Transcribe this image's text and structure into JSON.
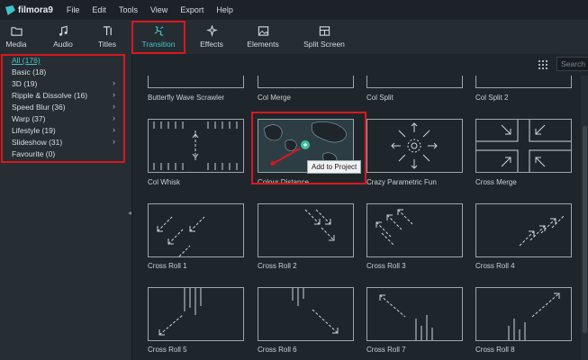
{
  "app": {
    "logo_text": "filmora9",
    "menu": [
      "File",
      "Edit",
      "Tools",
      "View",
      "Export",
      "Help"
    ]
  },
  "toolbar": {
    "tabs": [
      {
        "label": "Media",
        "icon": "folder-icon"
      },
      {
        "label": "Audio",
        "icon": "music-note-icon"
      },
      {
        "label": "Titles",
        "icon": "text-title-icon"
      },
      {
        "label": "Transition",
        "icon": "transition-icon",
        "active": true
      },
      {
        "label": "Effects",
        "icon": "effects-sparkle-icon"
      },
      {
        "label": "Elements",
        "icon": "image-icon"
      },
      {
        "label": "Split Screen",
        "icon": "split-screen-icon"
      }
    ],
    "accent_color": "#46c3c8"
  },
  "sidebar": {
    "categories": [
      {
        "label": "All (176)",
        "selected": true,
        "expandable": false
      },
      {
        "label": "Basic (18)",
        "expandable": false
      },
      {
        "label": "3D (19)",
        "expandable": true
      },
      {
        "label": "Ripple & Dissolve (16)",
        "expandable": true
      },
      {
        "label": "Speed Blur (36)",
        "expandable": true
      },
      {
        "label": "Warp (37)",
        "expandable": true
      },
      {
        "label": "Lifestyle (19)",
        "expandable": true
      },
      {
        "label": "Slideshow (31)",
        "expandable": true
      },
      {
        "label": "Favourite (0)",
        "expandable": false
      }
    ]
  },
  "content": {
    "search_placeholder": "Search",
    "top_row": [
      "Butterfly Wave Scrawler",
      "Col Merge",
      "Col Split",
      "Col Split 2"
    ],
    "items": [
      {
        "label": "Col Whisk",
        "icon": "col-whisk-icon"
      },
      {
        "label": "Colour Distance",
        "icon": "colour-distance-icon",
        "hovered": true
      },
      {
        "label": "Crazy Parametric Fun",
        "icon": "crazy-parametric-icon"
      },
      {
        "label": "Cross Merge",
        "icon": "cross-merge-icon"
      },
      {
        "label": "Cross Roll 1",
        "icon": "cross-roll-icon"
      },
      {
        "label": "Cross Roll 2",
        "icon": "cross-roll-icon"
      },
      {
        "label": "Cross Roll 3",
        "icon": "cross-roll-icon"
      },
      {
        "label": "Cross Roll 4",
        "icon": "cross-roll-icon"
      },
      {
        "label": "Cross Roll 5",
        "icon": "cross-roll-icon"
      },
      {
        "label": "Cross Roll 6",
        "icon": "cross-roll-icon"
      },
      {
        "label": "Cross Roll 7",
        "icon": "cross-roll-icon"
      },
      {
        "label": "Cross Roll 8",
        "icon": "cross-roll-icon"
      }
    ],
    "tooltip": "Add to Project",
    "highlight_color": "#d9171f"
  }
}
